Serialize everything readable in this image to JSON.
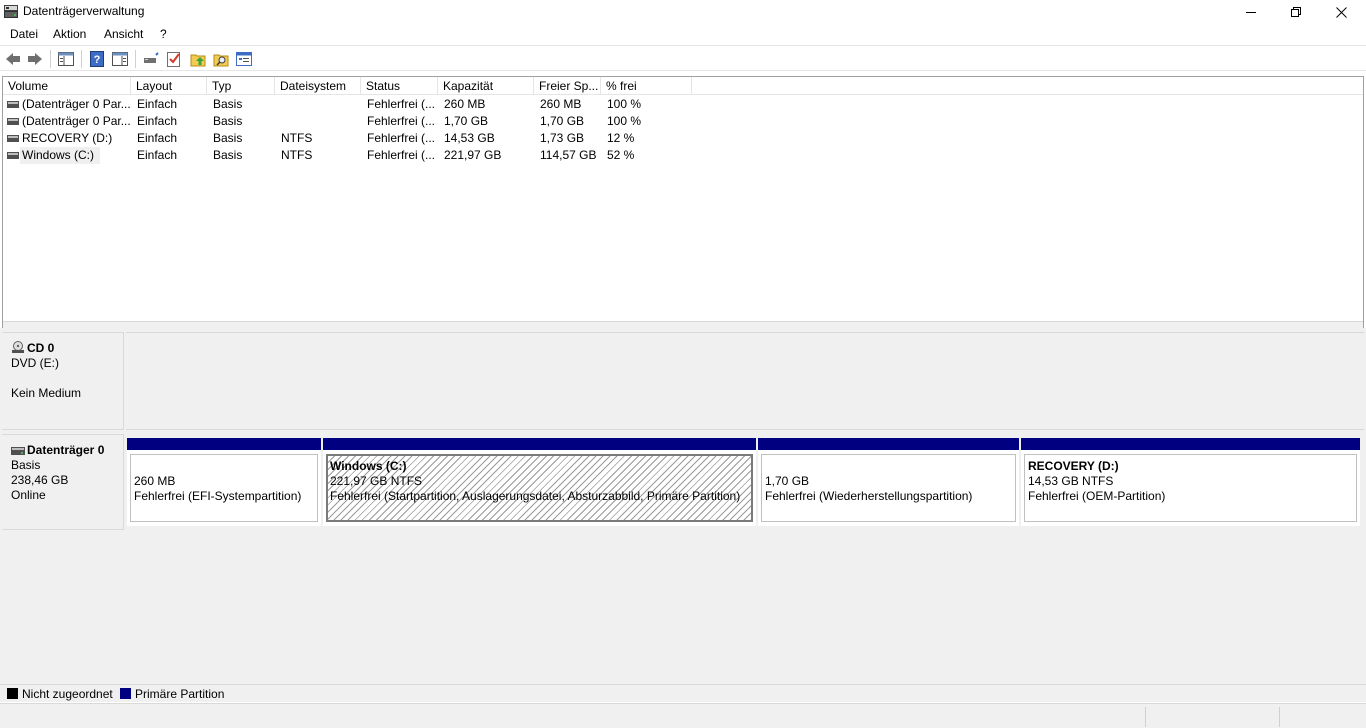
{
  "window": {
    "title": "Datenträgerverwaltung"
  },
  "menu": {
    "items": [
      {
        "label": "Datei",
        "name": "menu-datei"
      },
      {
        "label": "Aktion",
        "name": "menu-aktion"
      },
      {
        "label": "Ansicht",
        "name": "menu-ansicht"
      },
      {
        "label": "?",
        "name": "menu-help"
      }
    ]
  },
  "toolbar": {
    "buttons": [
      "back-icon",
      "forward-icon",
      "show-hide-console-tree-icon",
      "help-icon",
      "show-action-pane-icon",
      "connect-virtual-disk-icon",
      "check-icon",
      "go-up-icon",
      "search-icon",
      "properties-icon"
    ]
  },
  "volume_list": {
    "columns": [
      "Volume",
      "Layout",
      "Typ",
      "Dateisystem",
      "Status",
      "Kapazität",
      "Freier Sp...",
      "% frei"
    ],
    "rows": [
      [
        "(Datenträger 0 Par...",
        "Einfach",
        "Basis",
        "",
        "Fehlerfrei (...",
        "260 MB",
        "260 MB",
        "100 %"
      ],
      [
        "(Datenträger 0 Par...",
        "Einfach",
        "Basis",
        "",
        "Fehlerfrei (...",
        "1,70 GB",
        "1,70 GB",
        "100 %"
      ],
      [
        "RECOVERY (D:)",
        "Einfach",
        "Basis",
        "NTFS",
        "Fehlerfrei (...",
        "14,53 GB",
        "1,73 GB",
        "12 %"
      ],
      [
        "Windows (C:)",
        "Einfach",
        "Basis",
        "NTFS",
        "Fehlerfrei (...",
        "221,97 GB",
        "114,57 GB",
        "52 %"
      ]
    ]
  },
  "cd0": {
    "name": "CD 0",
    "drive": "DVD (E:)",
    "media": "Kein Medium"
  },
  "disk0": {
    "name": "Datenträger 0",
    "type": "Basis",
    "size": "238,46 GB",
    "state": "Online",
    "partitions": [
      {
        "name": "",
        "size": "260 MB",
        "status": "Fehlerfrei (EFI-Systempartition)"
      },
      {
        "name": "Windows  (C:)",
        "size": "221,97 GB NTFS",
        "status": "Fehlerfrei (Startpartition, Auslagerungsdatei, Absturzabbild, Primäre Partition)"
      },
      {
        "name": "",
        "size": "1,70 GB",
        "status": "Fehlerfrei (Wiederherstellungspartition)"
      },
      {
        "name": "RECOVERY  (D:)",
        "size": "14,53 GB NTFS",
        "status": "Fehlerfrei (OEM-Partition)"
      }
    ]
  },
  "legend": {
    "unallocated_label": "Nicht zugeordnet",
    "unallocated_color": "#000000",
    "primary_label": "Primäre Partition",
    "primary_color": "#000080"
  }
}
